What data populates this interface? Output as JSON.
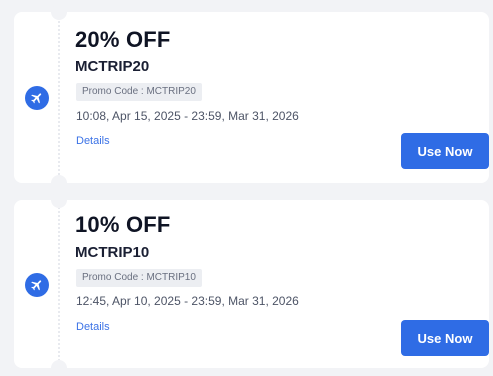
{
  "coupons": [
    {
      "title": "20% OFF",
      "code": "MCTRIP20",
      "promo_label": "Promo Code : MCTRIP20",
      "validity": "10:08, Apr 15, 2025 - 23:59, Mar 31, 2026",
      "details_label": "Details",
      "button_label": "Use Now",
      "icon": "airplane-icon"
    },
    {
      "title": "10% OFF",
      "code": "MCTRIP10",
      "promo_label": "Promo Code : MCTRIP10",
      "validity": "12:45, Apr 10, 2025 - 23:59, Mar 31, 2026",
      "details_label": "Details",
      "button_label": "Use Now",
      "icon": "airplane-icon"
    }
  ],
  "colors": {
    "accent": "#2f6ce5",
    "background": "#f2f3f6",
    "card": "#ffffff",
    "link": "#3b72e6"
  }
}
